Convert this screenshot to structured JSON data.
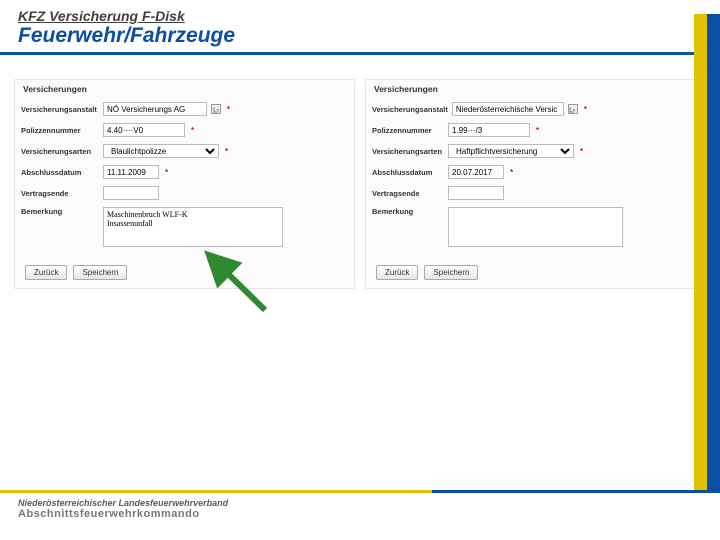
{
  "header": {
    "supertitle": "KFZ Versicherung F-Disk",
    "title": "Feuerwehr/Fahrzeuge"
  },
  "panel_heading": "Versicherungen",
  "labels": {
    "anstalt": "Versicherungsanstalt",
    "polizze": "Polizzennummer",
    "arten": "Versicherungsarten",
    "abschluss": "Abschlussdatum",
    "vertragsende": "Vertragsende",
    "bemerkung": "Bemerkung"
  },
  "buttons": {
    "back": "Zurück",
    "save": "Speichern"
  },
  "left": {
    "anstalt": "NÖ Versicherungs AG",
    "polizze": "4.40····V0",
    "art_selected": "Blaulichtpolizze",
    "abschluss": "11.11.2009",
    "vertragsende": "",
    "bemerkung": "Maschinenbruch WLF-K\nInsassenunfall"
  },
  "right": {
    "anstalt": "Niederösterreichische Versic",
    "polizze": "1.99···/3",
    "art_selected": "Haftpflichtversicherung",
    "abschluss": "20.07.2017",
    "vertragsende": "",
    "bemerkung": ""
  },
  "footer": {
    "org": "Niederösterreichischer Landesfeuerwehrverband",
    "sub": "Abschnittsfeuerwehrkommando"
  },
  "star": "*"
}
